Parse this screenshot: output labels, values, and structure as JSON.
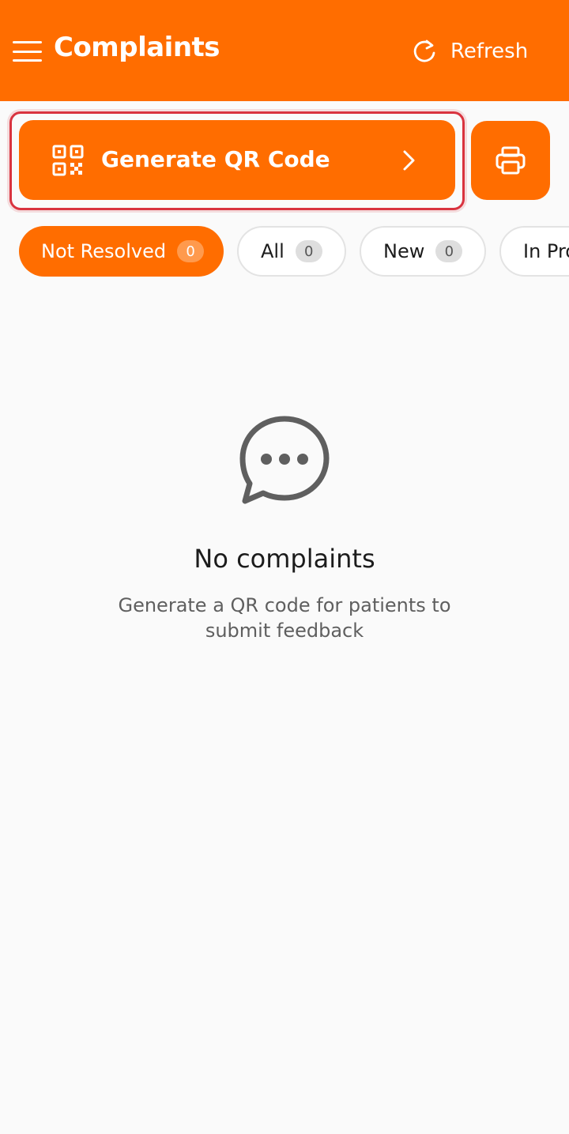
{
  "header": {
    "title": "Complaints",
    "refresh_label": "Refresh",
    "background": "#ff6d00"
  },
  "actions": {
    "generate_qr_label": "Generate QR Code",
    "qr_icon": "qr-code-icon",
    "print_icon": "printer-icon"
  },
  "filters": [
    {
      "label": "Not Resolved",
      "count": "0",
      "active": true
    },
    {
      "label": "All",
      "count": "0",
      "active": false
    },
    {
      "label": "New",
      "count": "0",
      "active": false
    },
    {
      "label": "In Pro",
      "count": "",
      "active": false
    }
  ],
  "empty_state": {
    "icon": "chat-bubble-icon",
    "title": "No complaints",
    "subtitle": "Generate a QR code for patients to submit feedback"
  },
  "colors": {
    "accent": "#ff6d00",
    "highlight_border": "#d9333f"
  }
}
